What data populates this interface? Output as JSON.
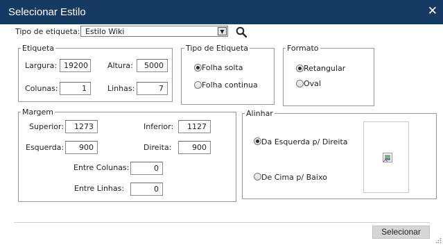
{
  "window": {
    "title": "Selecionar Estilo"
  },
  "tipo": {
    "label": "Tipo de etiqueta:",
    "value": "Estilo Wiki"
  },
  "etiqueta": {
    "legend": "Etiqueta",
    "largura_label": "Largura:",
    "largura": "19200",
    "altura_label": "Altura:",
    "altura": "5000",
    "colunas_label": "Colunas:",
    "colunas": "1",
    "linhas_label": "Linhas:",
    "linhas": "7"
  },
  "tipo_etiqueta": {
    "legend": "Tipo de Etiqueta",
    "options": [
      "Folha solta",
      "Folha continua"
    ],
    "selected": 0
  },
  "formato": {
    "legend": "Formato",
    "options": [
      "Retangular",
      "Oval"
    ],
    "selected": 0
  },
  "margem": {
    "legend": "Margem",
    "superior_label": "Superior:",
    "superior": "1273",
    "inferior_label": "Inferior:",
    "inferior": "1127",
    "esquerda_label": "Esquerda:",
    "esquerda": "900",
    "direita_label": "Direita:",
    "direita": "900",
    "entre_colunas_label": "Entre Colunas:",
    "entre_colunas": "0",
    "entre_linhas_label": "Entre Linhas:",
    "entre_linhas": "0"
  },
  "alinhar": {
    "legend": "Alinhar",
    "options": [
      "Da Esquerda p/ Direita",
      "De Cima p/ Baixo"
    ],
    "selected": 0
  },
  "footer": {
    "button": "Selecionar"
  },
  "colors": {
    "titlebar": "#173a63",
    "button": "#d6d6d6"
  }
}
